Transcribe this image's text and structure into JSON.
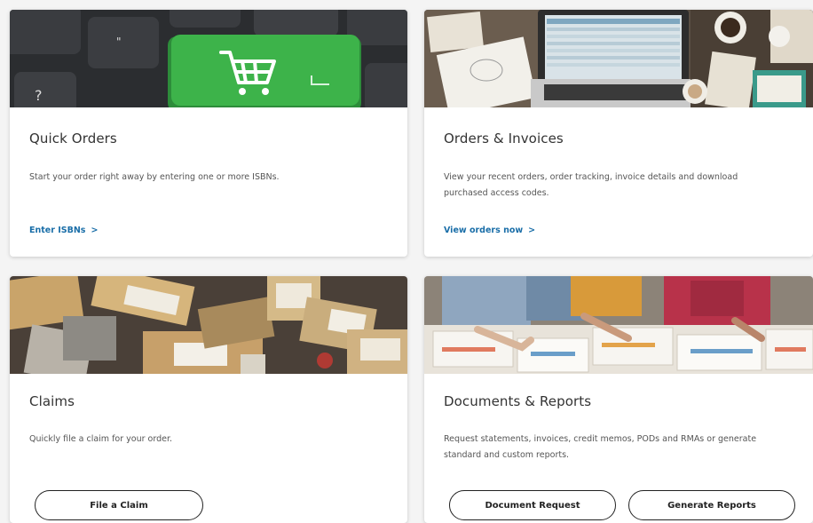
{
  "cards": {
    "quick_orders": {
      "title": "Quick Orders",
      "description": "Start your order right away by entering one or more ISBNs.",
      "link_label": "Enter ISBNs",
      "link_chevron": ">",
      "image_icon": "keyboard-cart-icon"
    },
    "orders_invoices": {
      "title": "Orders & Invoices",
      "description": "View your recent orders, order tracking, invoice details and download purchased access codes.",
      "link_label": "View orders now",
      "link_chevron": ">",
      "image_icon": "laptop-desk-photo"
    },
    "claims": {
      "title": "Claims",
      "description": "Quickly file a claim for your order.",
      "button_label": "File a Claim",
      "image_icon": "packages-photo"
    },
    "documents_reports": {
      "title": "Documents & Reports",
      "description": "Request statements, invoices, credit memos, PODs and RMAs or generate standard and custom reports.",
      "button_primary": "Document Request",
      "button_secondary": "Generate Reports",
      "image_icon": "team-reports-photo"
    }
  },
  "colors": {
    "link": "#1a6ea8",
    "cart_key": "#3db34a",
    "background": "#f4f4f4",
    "card": "#ffffff"
  }
}
